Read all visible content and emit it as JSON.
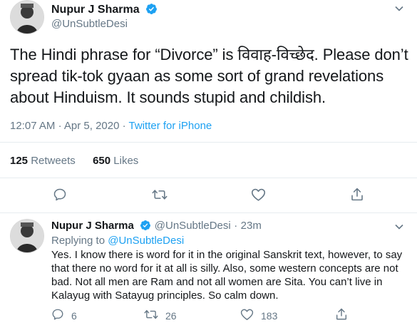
{
  "tweet": {
    "author_name": "Nupur J Sharma",
    "author_handle": "@UnSubtleDesi",
    "text": "The Hindi phrase for “Divorce” is विवाह-विच्छेद. Please don’t spread tik-tok gyaan as some sort of grand revelations about Hinduism. It sounds stupid and childish.",
    "time": "12:07 AM",
    "date": "Apr 5, 2020",
    "source": "Twitter for iPhone",
    "separator": "·",
    "retweets_count": "125",
    "retweets_label": "Retweets",
    "likes_count": "650",
    "likes_label": "Likes"
  },
  "reply": {
    "author_name": "Nupur J Sharma",
    "author_handle": "@UnSubtleDesi",
    "age": "23m",
    "separator": "·",
    "replying_label": "Replying to",
    "replying_handle": "@UnSubtleDesi",
    "text": "Yes. I know there is word for it in the original Sanskrit text, however, to say that there no word for it at all is silly. Also, some western concepts are not bad. Not all men are Ram and not all women are Sita. You can’t live in Kalayug with Satayug principles. So calm down.",
    "reply_count": "6",
    "retweet_count": "26",
    "like_count": "183"
  },
  "icons": {
    "verified": "verified-badge-icon",
    "more": "chevron-down-icon",
    "reply": "comment-icon",
    "retweet": "retweet-icon",
    "like": "heart-icon",
    "share": "share-icon"
  },
  "colors": {
    "text": "#14171a",
    "muted": "#657786",
    "accent": "#1da1f2",
    "divider": "#e6ecf0"
  }
}
